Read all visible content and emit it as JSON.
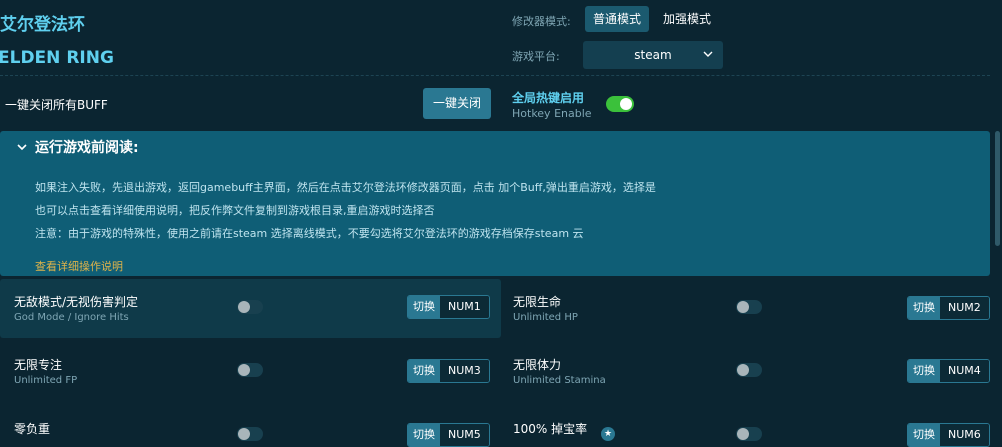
{
  "header": {
    "title_cn": "艾尔登法环",
    "title_en": "ELDEN RING",
    "mode_label": "修改器模式:",
    "mode_normal": "普通模式",
    "mode_enhanced": "加强模式",
    "platform_label": "游戏平台:",
    "platform_value": "steam"
  },
  "controls": {
    "close_all_label": "一键关闭所有BUFF",
    "close_all_button": "一键关闭",
    "hotkey_cn": "全局热键启用",
    "hotkey_en": "Hotkey Enable"
  },
  "notice": {
    "title": "运行游戏前阅读:",
    "lines": [
      "如果注入失败，先退出游戏，返回gamebuff主界面，然后在点击艾尔登法环修改器页面，点击 加个Buff,弹出重启游戏，选择是",
      "也可以点击查看详细使用说明，把反作弊文件复制到游戏根目录,重启游戏时选择否",
      "注意：由于游戏的特殊性，使用之前请在steam 选择离线模式，不要勾选将艾尔登法环的游戏存档保存steam 云"
    ],
    "link": "查看详细操作说明"
  },
  "cheats": [
    {
      "cn": "无敌模式/无视伤害判定",
      "en": "God Mode / Ignore Hits",
      "switch_label": "切换",
      "key": "NUM1"
    },
    {
      "cn": "无限生命",
      "en": "Unlimited HP",
      "switch_label": "切换",
      "key": "NUM2"
    },
    {
      "cn": "无限专注",
      "en": "Unlimited FP",
      "switch_label": "切换",
      "key": "NUM3"
    },
    {
      "cn": "无限体力",
      "en": "Unlimited Stamina",
      "switch_label": "切换",
      "key": "NUM4"
    },
    {
      "cn": "零负重",
      "en": "",
      "switch_label": "切换",
      "key": "NUM5"
    },
    {
      "cn": "100% 掉宝率",
      "en": "",
      "switch_label": "切换",
      "key": "NUM6"
    }
  ],
  "colors": {
    "background": "#0b2531",
    "accent": "#5fd0ef",
    "notice_bg": "#0f5e76",
    "button": "#2a7892",
    "toggle_on": "#3bc13b",
    "link": "#e0b44a"
  },
  "icons": {
    "dropdown": "chevron-down-icon",
    "notice_toggle": "chevron-down-icon",
    "premium": "star-icon"
  }
}
